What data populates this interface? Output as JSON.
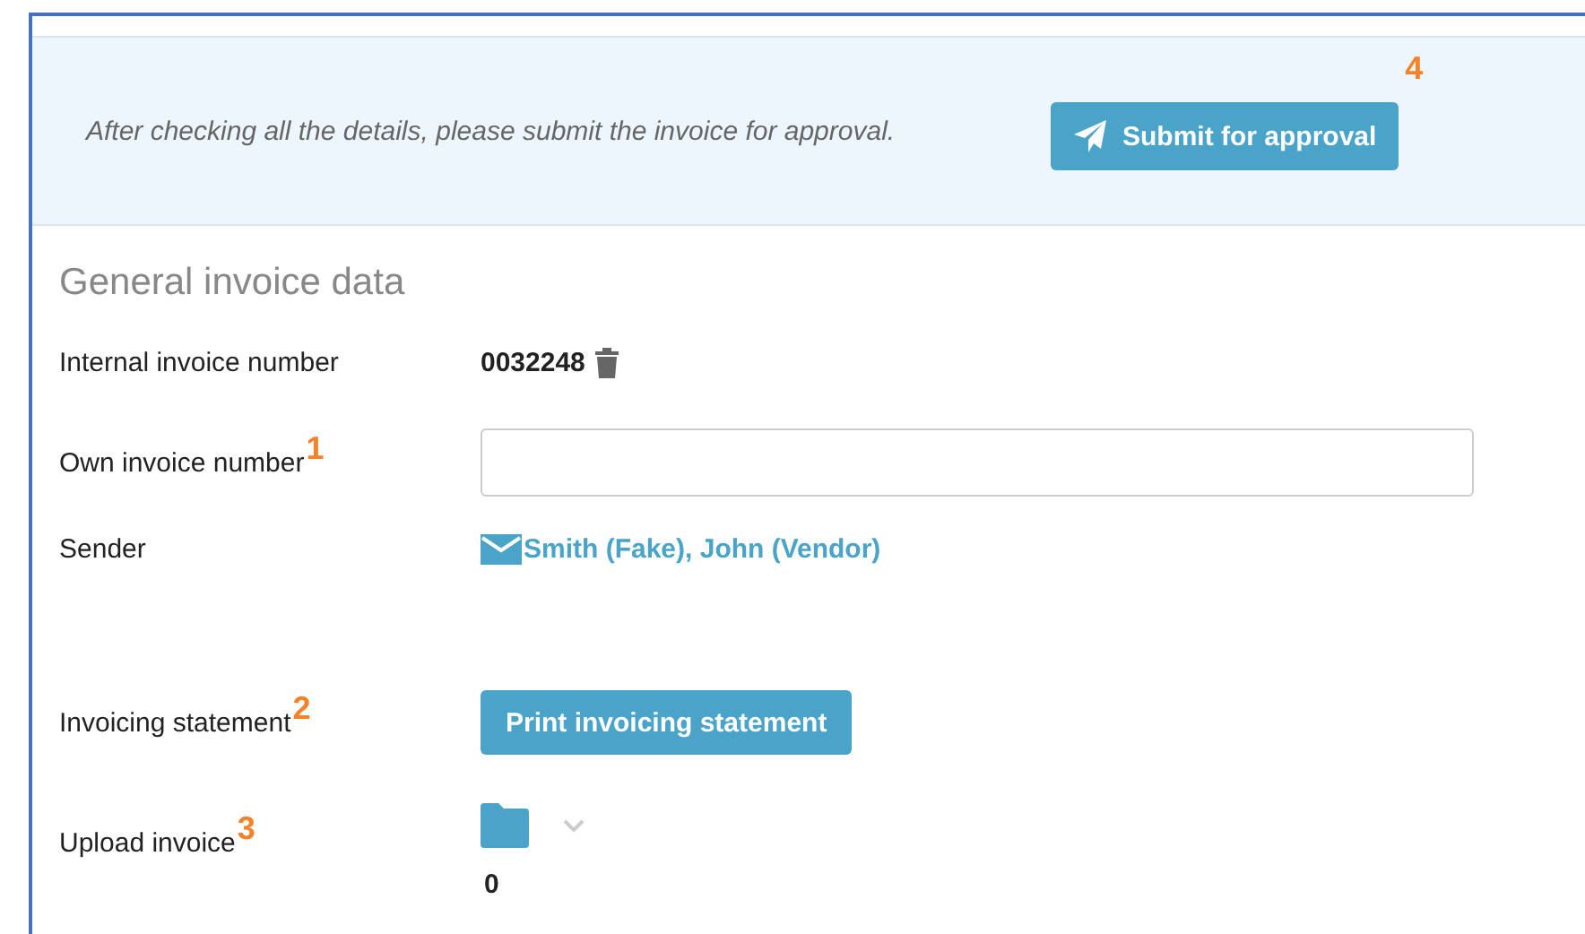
{
  "notice": {
    "text": "After checking all the details, please submit the invoice for approval.",
    "button": "Submit for approval",
    "marker": "4"
  },
  "section": {
    "title": "General invoice data"
  },
  "fields": [
    {
      "kind": "text",
      "label": "Internal invoice number",
      "value": "0032248"
    },
    {
      "kind": "input",
      "label": "Own invoice number",
      "marker": "1"
    },
    {
      "kind": "link",
      "label": "Sender",
      "value": "Smith (Fake), John (Vendor)"
    },
    {
      "kind": "button",
      "label": "Invoicing statement",
      "marker": "2",
      "button": "Print invoicing statement"
    },
    {
      "kind": "upload",
      "label": "Upload invoice",
      "marker": "3",
      "count": "0"
    }
  ]
}
